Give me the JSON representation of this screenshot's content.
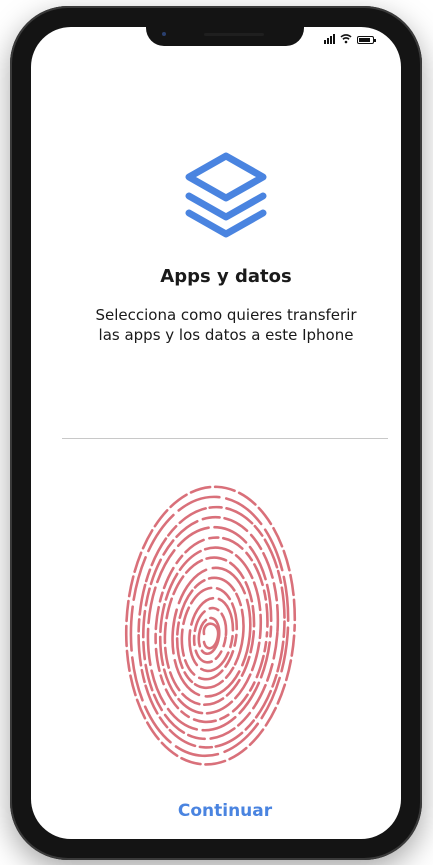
{
  "screen": {
    "title": "Apps y datos",
    "subtitle_line1": "Selecciona como quieres transferir",
    "subtitle_line2": "las apps y los datos a este Iphone",
    "continue_label": "Continuar"
  },
  "icons": {
    "header": "layers-icon",
    "biometric": "fingerprint-icon"
  },
  "colors": {
    "accent": "#4a84e0",
    "fingerprint": "#d9707a",
    "text": "#1a1a1a"
  }
}
